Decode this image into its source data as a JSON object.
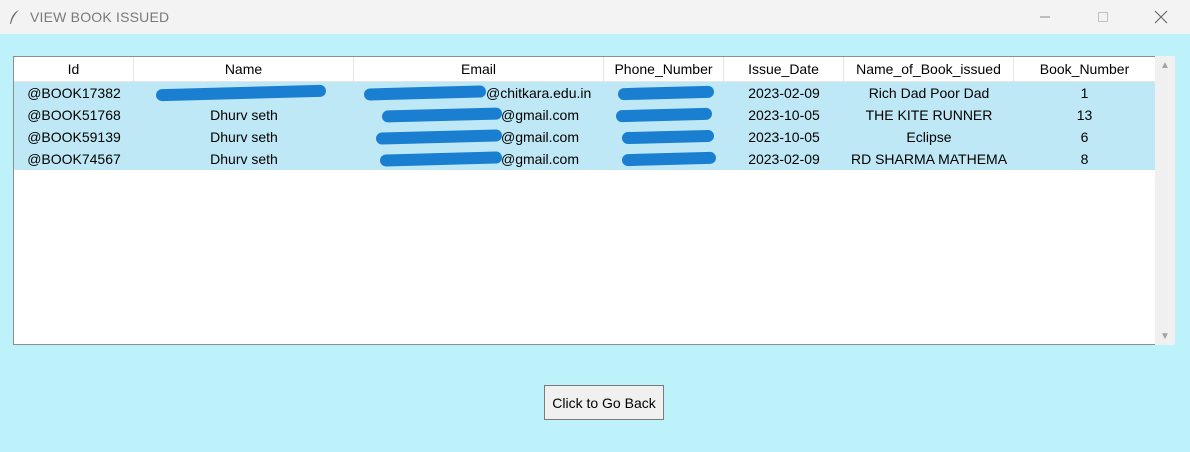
{
  "window": {
    "title": "VIEW BOOK ISSUED",
    "icon": "feather-icon",
    "controls": [
      "minimize-icon",
      "maximize-icon",
      "close-icon"
    ]
  },
  "table": {
    "columns": [
      "Id",
      "Name",
      "Email",
      "Phone_Number",
      "Issue_Date",
      "Name_of_Book_issued",
      "Book_Number"
    ],
    "rows": [
      {
        "id": "@BOOK17382",
        "name": "",
        "email": "@chitkara.edu.in",
        "phone": "",
        "issue_date": "2023-02-09",
        "book": "Rich Dad Poor Dad",
        "book_number": "1"
      },
      {
        "id": "@BOOK51768",
        "name": "Dhurv seth",
        "email": "@gmail.com",
        "phone": "",
        "issue_date": "2023-10-05",
        "book": "THE KITE RUNNER",
        "book_number": "13"
      },
      {
        "id": "@BOOK59139",
        "name": "Dhurv seth",
        "email": "@gmail.com",
        "phone": "",
        "issue_date": "2023-10-05",
        "book": "Eclipse",
        "book_number": "6"
      },
      {
        "id": "@BOOK74567",
        "name": "Dhurv seth",
        "email": "@gmail.com",
        "phone": "",
        "issue_date": "2023-02-09",
        "book": "RD SHARMA MATHEMA",
        "book_number": "8"
      }
    ],
    "selected_row_color": "#bfe8f6"
  },
  "back_button": {
    "label": "Click to Go Back"
  },
  "colors": {
    "window_bg": "#bdf2fb",
    "redaction": "#1a7fd1"
  }
}
